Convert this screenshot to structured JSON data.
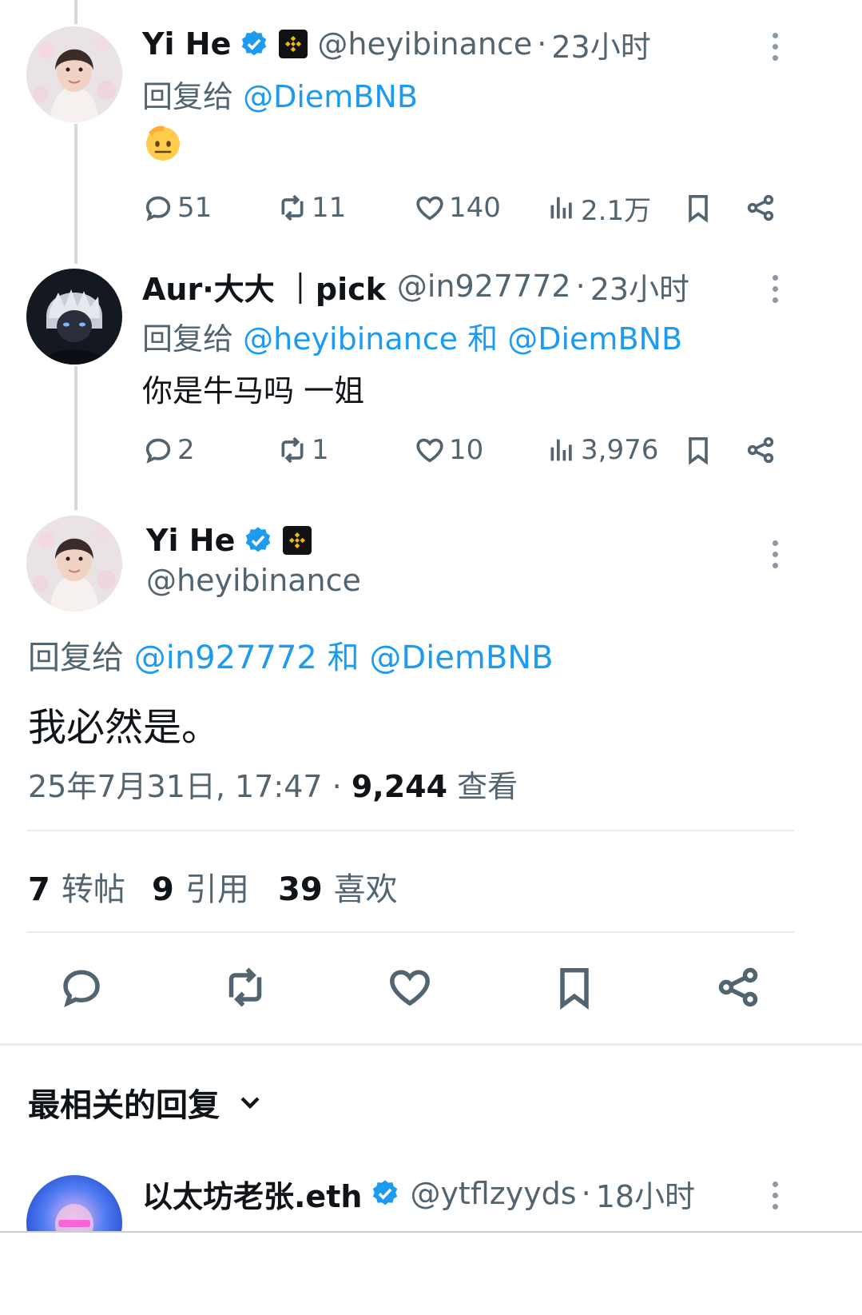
{
  "tweets": [
    {
      "name": "Yi He",
      "handle": "@heyibinance",
      "time": "23小时",
      "reply_prefix": "回复给",
      "reply_mentions": [
        "@DiemBNB"
      ],
      "reply_joiner": "",
      "text": "🫡",
      "replies": "51",
      "reposts": "11",
      "likes": "140",
      "views": "2.1万"
    },
    {
      "name": "Aur·大大 ｜pick",
      "handle": "@in927772",
      "time": "23小时",
      "reply_prefix": "回复给",
      "reply_mentions": [
        "@heyibinance",
        "@DiemBNB"
      ],
      "reply_joiner": "和",
      "text": "你是牛马吗 一姐",
      "replies": "2",
      "reposts": "1",
      "likes": "10",
      "views": "3,976"
    }
  ],
  "main": {
    "name": "Yi He",
    "handle": "@heyibinance",
    "reply_prefix": "回复给",
    "reply_mention_1": "@in927772",
    "reply_joiner": "和",
    "reply_mention_2": "@DiemBNB",
    "text": "我必然是。",
    "timestamp": "25年7月31日, 17:47",
    "views_count": "9,244",
    "views_label": "查看",
    "stats": {
      "reposts_count": "7",
      "reposts_label": "转帖",
      "quotes_count": "9",
      "quotes_label": "引用",
      "likes_count": "39",
      "likes_label": "喜欢"
    }
  },
  "replies_section": {
    "sort_label": "最相关的回复"
  },
  "next_reply": {
    "name": "以太坊老张.eth",
    "handle": "@ytflzyyds",
    "time": "18小时"
  },
  "colors": {
    "link": "#1d9bf0",
    "secondary": "#536471",
    "verified": "#1d9bf0",
    "binance": "#f0b90b"
  }
}
